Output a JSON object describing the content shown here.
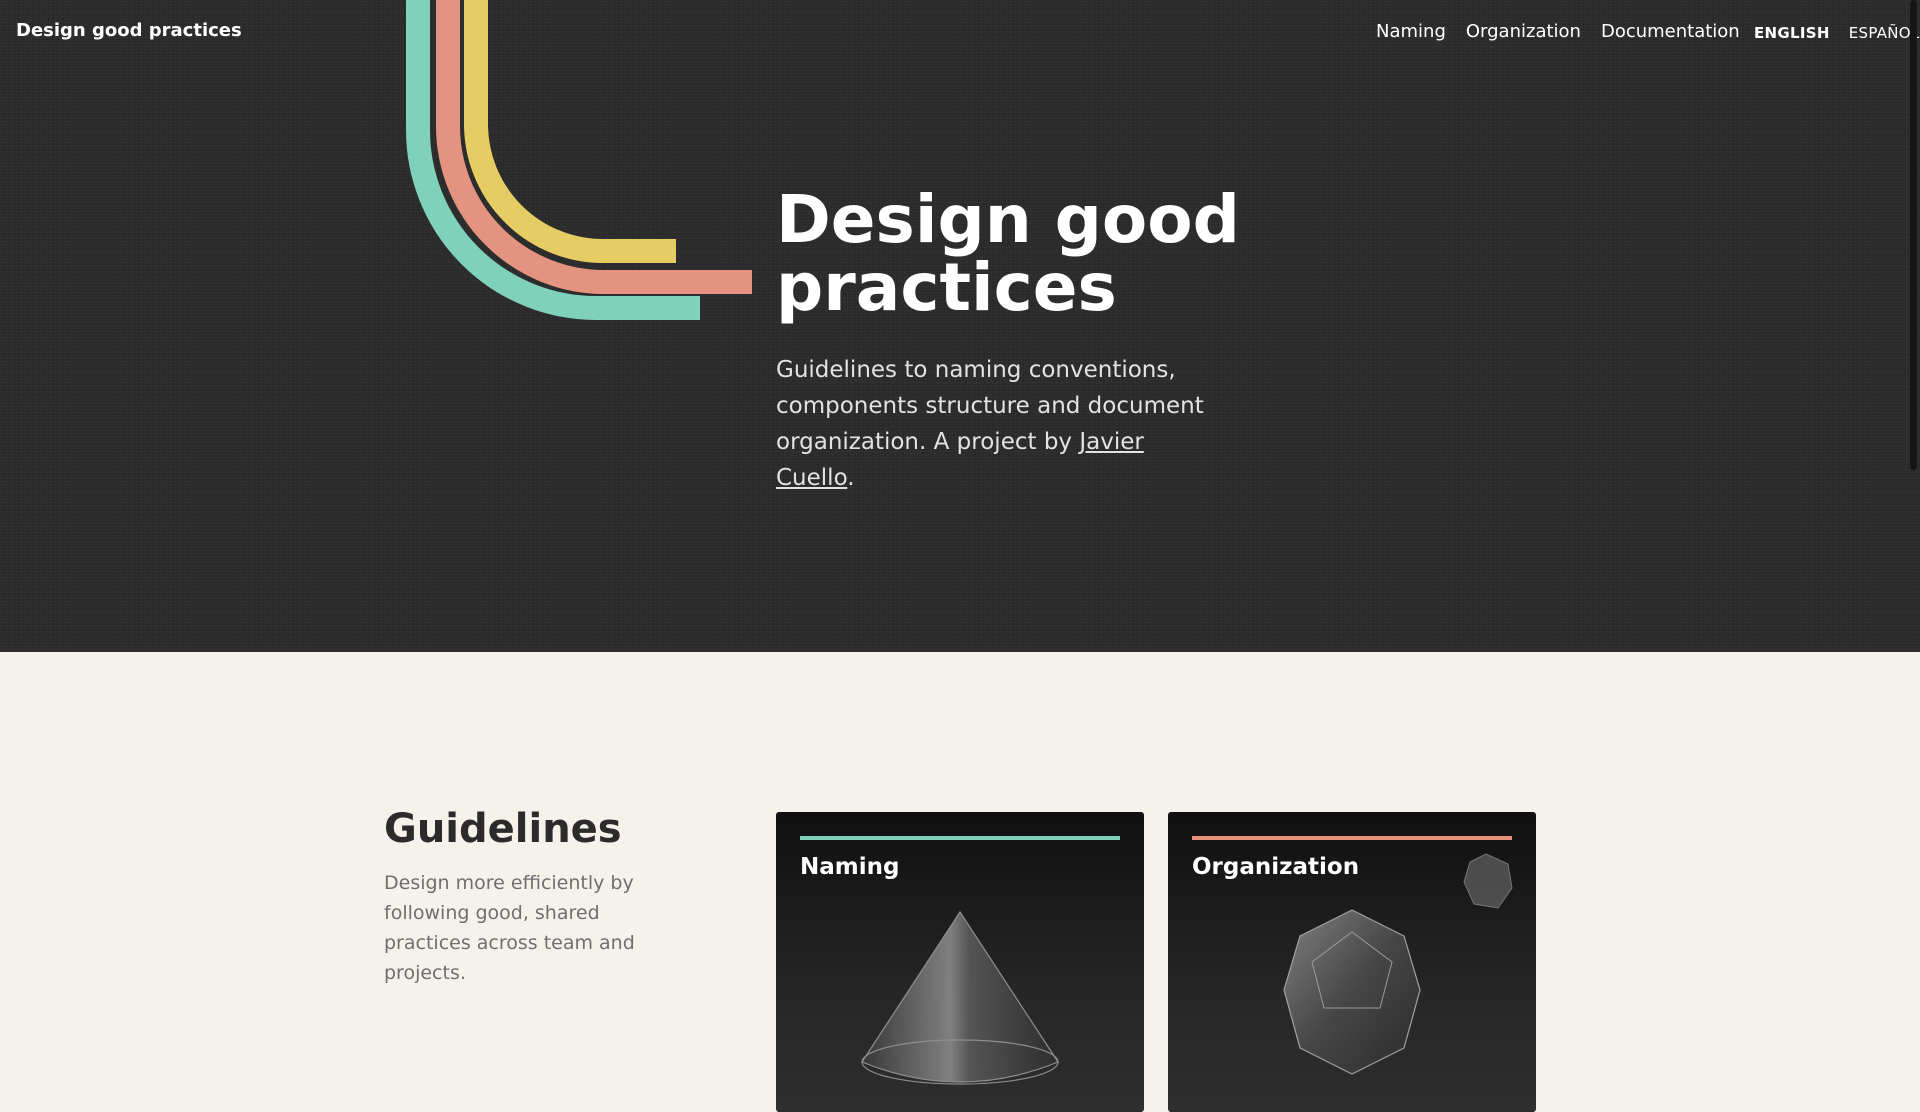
{
  "header": {
    "brand": "Design good practices",
    "nav": [
      "Naming",
      "Organization",
      "Documentation"
    ],
    "languages": [
      {
        "label": "ENGLISH",
        "active": true
      },
      {
        "label": "ESPAÑOL",
        "active": false
      }
    ]
  },
  "hero": {
    "title": "Design good practices",
    "lead_text": "Guidelines to naming conventions, components structure and document organization. A project by ",
    "author_link": "Javier Cuello",
    "lead_end": "."
  },
  "guidelines": {
    "title": "Guidelines",
    "description": "Design more efficiently by following good, shared practices across team and projects.",
    "cards": [
      {
        "title": "Naming",
        "accent": "#7fd1b9",
        "shape": "cone-icon"
      },
      {
        "title": "Organization",
        "accent": "#e8907a",
        "shape": "dodecahedron-icon"
      }
    ]
  },
  "colors": {
    "hero_bg": "#2b2b2b",
    "page_bg": "#f5f2ec",
    "stripe_green": "#7fd1b9",
    "stripe_pink": "#e59381",
    "stripe_yellow": "#e6cd63"
  }
}
